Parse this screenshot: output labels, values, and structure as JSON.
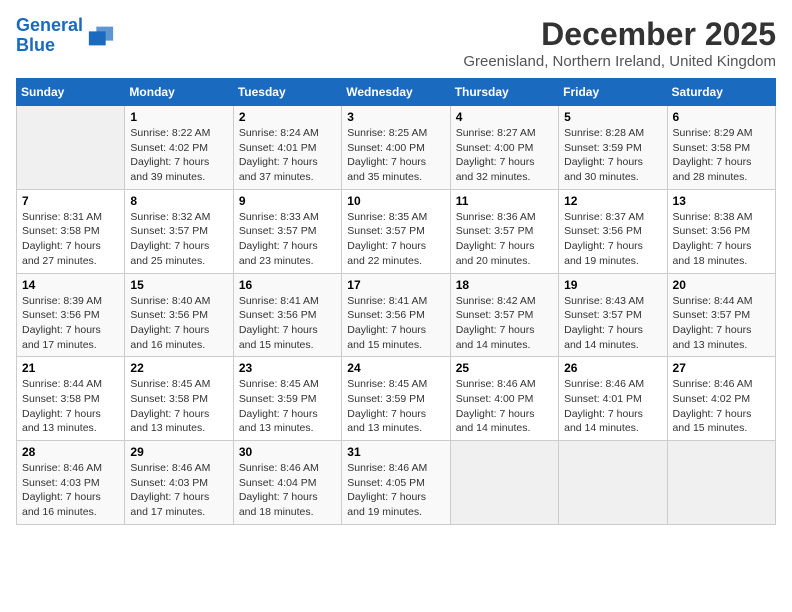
{
  "logo": {
    "line1": "General",
    "line2": "Blue"
  },
  "title": "December 2025",
  "location": "Greenisland, Northern Ireland, United Kingdom",
  "days_of_week": [
    "Sunday",
    "Monday",
    "Tuesday",
    "Wednesday",
    "Thursday",
    "Friday",
    "Saturday"
  ],
  "weeks": [
    [
      {
        "day": "",
        "info": ""
      },
      {
        "day": "1",
        "info": "Sunrise: 8:22 AM\nSunset: 4:02 PM\nDaylight: 7 hours\nand 39 minutes."
      },
      {
        "day": "2",
        "info": "Sunrise: 8:24 AM\nSunset: 4:01 PM\nDaylight: 7 hours\nand 37 minutes."
      },
      {
        "day": "3",
        "info": "Sunrise: 8:25 AM\nSunset: 4:00 PM\nDaylight: 7 hours\nand 35 minutes."
      },
      {
        "day": "4",
        "info": "Sunrise: 8:27 AM\nSunset: 4:00 PM\nDaylight: 7 hours\nand 32 minutes."
      },
      {
        "day": "5",
        "info": "Sunrise: 8:28 AM\nSunset: 3:59 PM\nDaylight: 7 hours\nand 30 minutes."
      },
      {
        "day": "6",
        "info": "Sunrise: 8:29 AM\nSunset: 3:58 PM\nDaylight: 7 hours\nand 28 minutes."
      }
    ],
    [
      {
        "day": "7",
        "info": "Sunrise: 8:31 AM\nSunset: 3:58 PM\nDaylight: 7 hours\nand 27 minutes."
      },
      {
        "day": "8",
        "info": "Sunrise: 8:32 AM\nSunset: 3:57 PM\nDaylight: 7 hours\nand 25 minutes."
      },
      {
        "day": "9",
        "info": "Sunrise: 8:33 AM\nSunset: 3:57 PM\nDaylight: 7 hours\nand 23 minutes."
      },
      {
        "day": "10",
        "info": "Sunrise: 8:35 AM\nSunset: 3:57 PM\nDaylight: 7 hours\nand 22 minutes."
      },
      {
        "day": "11",
        "info": "Sunrise: 8:36 AM\nSunset: 3:57 PM\nDaylight: 7 hours\nand 20 minutes."
      },
      {
        "day": "12",
        "info": "Sunrise: 8:37 AM\nSunset: 3:56 PM\nDaylight: 7 hours\nand 19 minutes."
      },
      {
        "day": "13",
        "info": "Sunrise: 8:38 AM\nSunset: 3:56 PM\nDaylight: 7 hours\nand 18 minutes."
      }
    ],
    [
      {
        "day": "14",
        "info": "Sunrise: 8:39 AM\nSunset: 3:56 PM\nDaylight: 7 hours\nand 17 minutes."
      },
      {
        "day": "15",
        "info": "Sunrise: 8:40 AM\nSunset: 3:56 PM\nDaylight: 7 hours\nand 16 minutes."
      },
      {
        "day": "16",
        "info": "Sunrise: 8:41 AM\nSunset: 3:56 PM\nDaylight: 7 hours\nand 15 minutes."
      },
      {
        "day": "17",
        "info": "Sunrise: 8:41 AM\nSunset: 3:56 PM\nDaylight: 7 hours\nand 15 minutes."
      },
      {
        "day": "18",
        "info": "Sunrise: 8:42 AM\nSunset: 3:57 PM\nDaylight: 7 hours\nand 14 minutes."
      },
      {
        "day": "19",
        "info": "Sunrise: 8:43 AM\nSunset: 3:57 PM\nDaylight: 7 hours\nand 14 minutes."
      },
      {
        "day": "20",
        "info": "Sunrise: 8:44 AM\nSunset: 3:57 PM\nDaylight: 7 hours\nand 13 minutes."
      }
    ],
    [
      {
        "day": "21",
        "info": "Sunrise: 8:44 AM\nSunset: 3:58 PM\nDaylight: 7 hours\nand 13 minutes."
      },
      {
        "day": "22",
        "info": "Sunrise: 8:45 AM\nSunset: 3:58 PM\nDaylight: 7 hours\nand 13 minutes."
      },
      {
        "day": "23",
        "info": "Sunrise: 8:45 AM\nSunset: 3:59 PM\nDaylight: 7 hours\nand 13 minutes."
      },
      {
        "day": "24",
        "info": "Sunrise: 8:45 AM\nSunset: 3:59 PM\nDaylight: 7 hours\nand 13 minutes."
      },
      {
        "day": "25",
        "info": "Sunrise: 8:46 AM\nSunset: 4:00 PM\nDaylight: 7 hours\nand 14 minutes."
      },
      {
        "day": "26",
        "info": "Sunrise: 8:46 AM\nSunset: 4:01 PM\nDaylight: 7 hours\nand 14 minutes."
      },
      {
        "day": "27",
        "info": "Sunrise: 8:46 AM\nSunset: 4:02 PM\nDaylight: 7 hours\nand 15 minutes."
      }
    ],
    [
      {
        "day": "28",
        "info": "Sunrise: 8:46 AM\nSunset: 4:03 PM\nDaylight: 7 hours\nand 16 minutes."
      },
      {
        "day": "29",
        "info": "Sunrise: 8:46 AM\nSunset: 4:03 PM\nDaylight: 7 hours\nand 17 minutes."
      },
      {
        "day": "30",
        "info": "Sunrise: 8:46 AM\nSunset: 4:04 PM\nDaylight: 7 hours\nand 18 minutes."
      },
      {
        "day": "31",
        "info": "Sunrise: 8:46 AM\nSunset: 4:05 PM\nDaylight: 7 hours\nand 19 minutes."
      },
      {
        "day": "",
        "info": ""
      },
      {
        "day": "",
        "info": ""
      },
      {
        "day": "",
        "info": ""
      }
    ]
  ]
}
